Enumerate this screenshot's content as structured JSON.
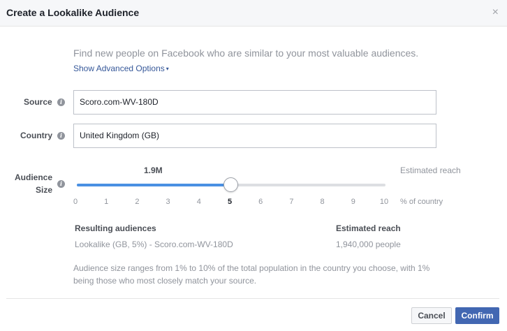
{
  "dialog": {
    "title": "Create a Lookalike Audience",
    "close_glyph": "×"
  },
  "intro": {
    "text": "Find new people on Facebook who are similar to your most valuable audiences.",
    "advanced_link": "Show Advanced Options",
    "caret_glyph": "▾"
  },
  "source": {
    "label": "Source",
    "value": "Scoro.com-WV-180D"
  },
  "country": {
    "label": "Country",
    "value": "United Kingdom (GB)"
  },
  "audience_size": {
    "label_line1": "Audience",
    "label_line2": "Size",
    "reach_value": "1.9M",
    "estimated_reach_label": "Estimated reach",
    "pct_label": "% of country",
    "selected_percent": 5,
    "ticks": [
      "0",
      "1",
      "2",
      "3",
      "4",
      "5",
      "6",
      "7",
      "8",
      "9",
      "10"
    ]
  },
  "results": {
    "col1_header": "Resulting audiences",
    "col1_value": "Lookalike (GB, 5%) - Scoro.com-WV-180D",
    "col2_header": "Estimated reach",
    "col2_value": "1,940,000 people"
  },
  "note": {
    "text": "Audience size ranges from 1% to 10% of the total population in the country you choose, with 1% being those who most closely match your source."
  },
  "footer": {
    "cancel_label": "Cancel",
    "confirm_label": "Confirm"
  },
  "icons": {
    "info": "i"
  },
  "colors": {
    "accent": "#4267b2",
    "link": "#365899",
    "slider_fill": "#4a90e2"
  }
}
